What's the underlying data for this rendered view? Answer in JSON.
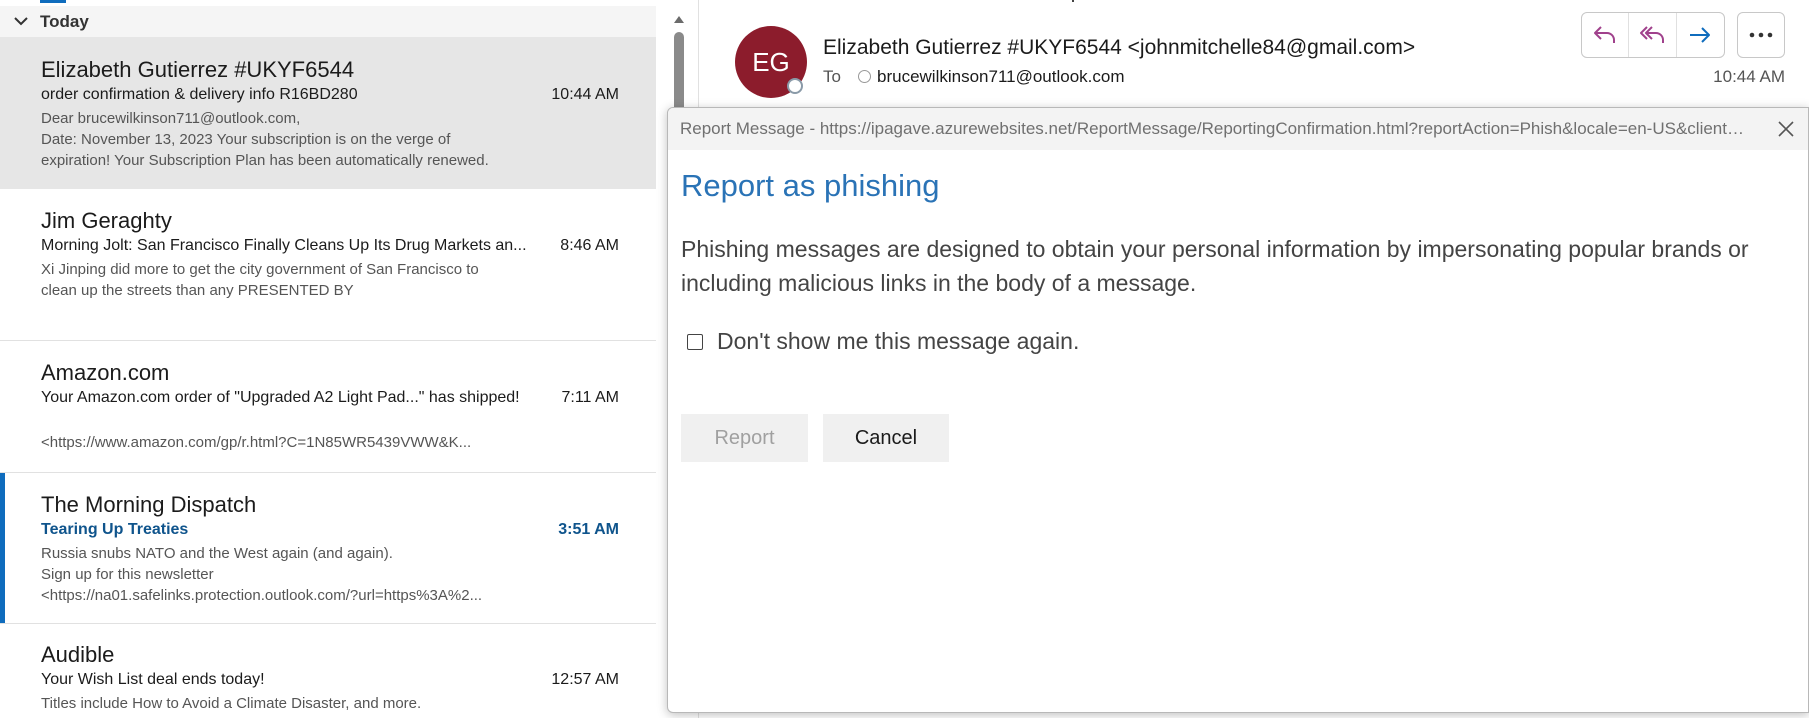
{
  "list": {
    "group_header": "Today",
    "items": [
      {
        "sender": "Elizabeth Gutierrez  #UKYF6544",
        "subject": "order confirmation & delivery info R16BD280",
        "time": "10:44 AM",
        "preview_lines": [
          "Dear brucewilkinson711@outlook.com,",
          "Date: November 13, 2023  Your subscription is on the verge of",
          "expiration! Your Subscription Plan has been automatically renewed."
        ]
      },
      {
        "sender": "Jim Geraghty",
        "subject": "Morning Jolt: San Francisco Finally Cleans Up Its Drug Markets an...",
        "time": "8:46 AM",
        "preview_lines": [
          "Xi Jinping did more to get the city government of San Francisco to",
          "clean up the streets than any   PRESENTED BY"
        ]
      },
      {
        "sender": "Amazon.com",
        "subject": "Your Amazon.com order of \"Upgraded A2 Light Pad...\" has shipped!",
        "time": "7:11 AM",
        "preview_lines": [
          "<https://www.amazon.com/gp/r.html?C=1N85WR5439VWW&K..."
        ]
      },
      {
        "sender": "The Morning Dispatch",
        "subject": "Tearing Up Treaties",
        "time": "3:51 AM",
        "preview_lines": [
          "Russia snubs NATO and the West again (and again).",
          "Sign up for this newsletter",
          "<https://na01.safelinks.protection.outlook.com/?url=https%3A%2..."
        ]
      },
      {
        "sender": "Audible",
        "subject": "Your Wish List deal ends today!",
        "time": "12:57 AM",
        "preview_lines": [
          "Titles include How to Avoid a Climate Disaster, and more."
        ]
      }
    ]
  },
  "reading_pane": {
    "avatar_initials": "EG",
    "from": "Elizabeth Gutierrez  #UKYF6544 <johnmitchelle84@gmail.com>",
    "to_label": "To",
    "to_address": "brucewilkinson711@outlook.com",
    "time": "10:44 AM"
  },
  "dialog": {
    "title": "Report Message - https://ipagave.azurewebsites.net/ReportMessage/ReportingConfirmation.html?reportAction=Phish&locale=en-US&client=Outlook",
    "heading": "Report as phishing",
    "body": "Phishing messages are designed to obtain your personal information by impersonating popular brands or including malicious links in the body of a message.",
    "checkbox_label": "Don't show me this message again.",
    "checkbox_checked": false,
    "report_label": "Report",
    "cancel_label": "Cancel"
  },
  "colors": {
    "accent": "#0f6cbd",
    "avatar_bg": "#8c1c2c",
    "dialog_heading": "#2a73b6",
    "action_icon_purple": "#a0418c",
    "action_icon_blue": "#0f6cbd"
  },
  "icons": {
    "group_collapse": "chevron-down-icon",
    "reply": "reply-icon",
    "reply_all": "reply-all-icon",
    "forward": "forward-icon",
    "more": "more-horizontal-icon",
    "close": "close-icon"
  }
}
